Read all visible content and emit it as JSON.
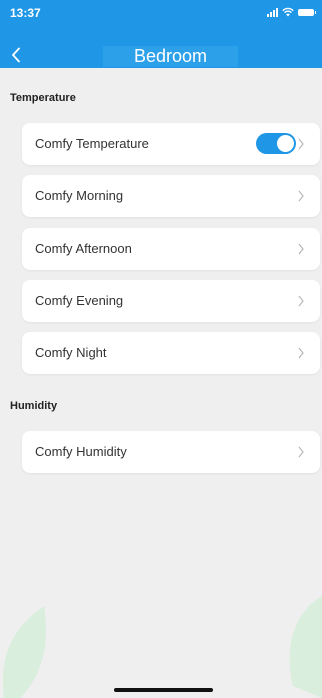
{
  "status_bar": {
    "time": "13:37"
  },
  "header": {
    "title": "Bedroom"
  },
  "temperature": {
    "heading": "Temperature",
    "items": [
      {
        "label": "Comfy Temperature",
        "toggle_on": true
      },
      {
        "label": "Comfy Morning"
      },
      {
        "label": "Comfy Afternoon"
      },
      {
        "label": "Comfy Evening"
      },
      {
        "label": "Comfy Night"
      }
    ]
  },
  "humidity": {
    "heading": "Humidity",
    "items": [
      {
        "label": "Comfy Humidity"
      }
    ]
  },
  "colors": {
    "accent": "#1f97e6",
    "background": "#efefef",
    "decor_leaf": "#d9eedd"
  }
}
